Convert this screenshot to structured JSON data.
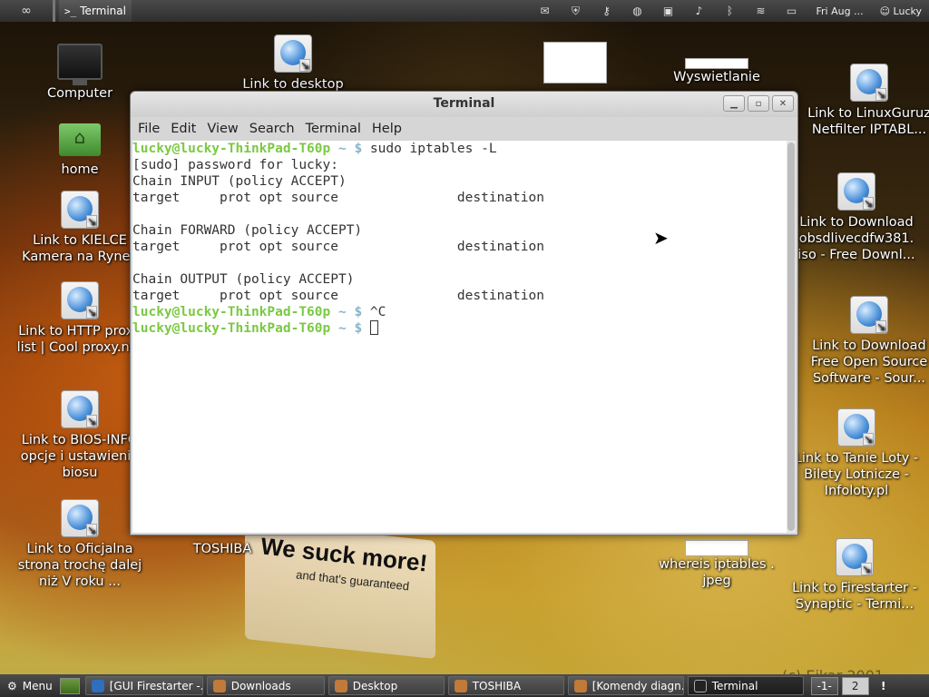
{
  "top_panel": {
    "active_app": "Terminal",
    "clock": "Fri Aug ...",
    "user": "Lucky",
    "tray_icons": [
      "mail-icon",
      "shield-icon",
      "network-key-icon",
      "bluetooth-icon",
      "monitor-icon",
      "display-icon",
      "volume-icon",
      "bluetooth-icon",
      "wifi-icon",
      "battery-icon"
    ]
  },
  "desktop": {
    "icons": [
      {
        "label": "Computer",
        "kind": "monitor"
      },
      {
        "label": "home",
        "kind": "folder"
      },
      {
        "label": "Link to KIELCE Kamera na Rynek",
        "kind": "link"
      },
      {
        "label": "Link to HTTP proxy list | Cool proxy.net",
        "kind": "link"
      },
      {
        "label": "Link to BIOS-INFO opcje i ustawienia biosu",
        "kind": "link"
      },
      {
        "label": "Link to Oficjalna strona trochę dalej niż V roku ...",
        "kind": "link"
      },
      {
        "label": "Link to desktop",
        "kind": "link"
      },
      {
        "label": "Wyswietlanie",
        "kind": "doc"
      },
      {
        "label": "Link to LinuxGuruz Netfilter IPTABL...",
        "kind": "link"
      },
      {
        "label": "Link to Download obsdlivecdfw381. iso - Free Downl...",
        "kind": "link"
      },
      {
        "label": "Link to Download Free Open Source Software - Sour...",
        "kind": "link"
      },
      {
        "label": "Link to Tanie Loty - Bilety Lotnicze - Infoloty.pl",
        "kind": "link"
      },
      {
        "label": "Link to Firestarter - Synaptic - Termi...",
        "kind": "link"
      },
      {
        "label": "whereis iptables . jpeg",
        "kind": "doc"
      },
      {
        "label": "TOSHIBA",
        "kind": "label"
      }
    ],
    "wallpaper_text": {
      "line1": "We suck more!",
      "line2": "and that's guaranteed",
      "copyright": "(c) Eikar 2001"
    }
  },
  "terminal": {
    "title": "Terminal",
    "menu": [
      "File",
      "Edit",
      "View",
      "Search",
      "Terminal",
      "Help"
    ],
    "prompt_user": "lucky@lucky-ThinkPad-T60p",
    "prompt_path": " ~ $ ",
    "lines": [
      {
        "type": "prompt",
        "cmd": "sudo iptables -L"
      },
      {
        "type": "out",
        "text": "[sudo] password for lucky:"
      },
      {
        "type": "out",
        "text": "Chain INPUT (policy ACCEPT)"
      },
      {
        "type": "out",
        "text": "target     prot opt source               destination"
      },
      {
        "type": "out",
        "text": ""
      },
      {
        "type": "out",
        "text": "Chain FORWARD (policy ACCEPT)"
      },
      {
        "type": "out",
        "text": "target     prot opt source               destination"
      },
      {
        "type": "out",
        "text": ""
      },
      {
        "type": "out",
        "text": "Chain OUTPUT (policy ACCEPT)"
      },
      {
        "type": "out",
        "text": "target     prot opt source               destination"
      },
      {
        "type": "prompt",
        "cmd": "^C"
      },
      {
        "type": "prompt_cursor",
        "cmd": ""
      }
    ]
  },
  "taskbar": {
    "menu_label": "Menu",
    "tasks": [
      {
        "label": "[GUI Firestarter -...",
        "icon": "firestarter",
        "active": false
      },
      {
        "label": "Downloads",
        "icon": "folder",
        "active": false
      },
      {
        "label": "Desktop",
        "icon": "folder",
        "active": false
      },
      {
        "label": "TOSHIBA",
        "icon": "folder",
        "active": false
      },
      {
        "label": "[Komendy diagn...",
        "icon": "browser",
        "active": false
      },
      {
        "label": "Terminal",
        "icon": "terminal",
        "active": true
      }
    ],
    "workspaces": [
      "-1-",
      "2"
    ],
    "notification": "!"
  }
}
